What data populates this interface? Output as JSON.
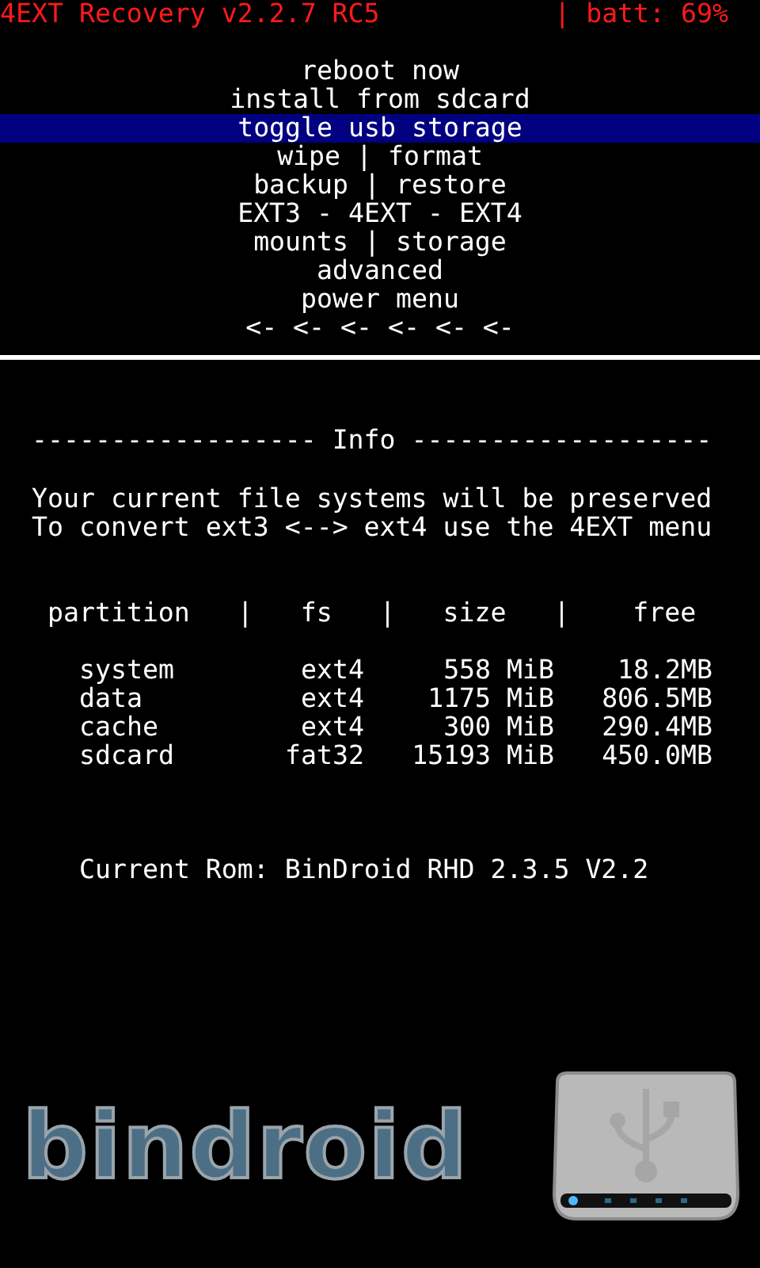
{
  "header": {
    "title": "4EXT Recovery v2.2.7 RC5",
    "battery": "| batt: 69%"
  },
  "menu": [
    {
      "label": "reboot now",
      "selected": false
    },
    {
      "label": "install from sdcard",
      "selected": false
    },
    {
      "label": "toggle usb storage",
      "selected": true
    },
    {
      "label": "wipe | format",
      "selected": false
    },
    {
      "label": "backup | restore",
      "selected": false
    },
    {
      "label": "EXT3 - 4EXT - EXT4",
      "selected": false
    },
    {
      "label": "mounts | storage",
      "selected": false
    },
    {
      "label": "advanced",
      "selected": false
    },
    {
      "label": "power menu",
      "selected": false
    },
    {
      "label": "<- <- <- <- <- <-",
      "selected": false
    }
  ],
  "info": {
    "heading": "------------------ Info -------------------",
    "lines": [
      "Your current file systems will be preserved",
      "To convert ext3 <--> ext4 use the 4EXT menu"
    ]
  },
  "partitions": {
    "header": "partition   |   fs   |   size   |    free",
    "rows": [
      {
        "partition": "system",
        "fs": "ext4",
        "size": "558 MiB",
        "free": "18.2MB"
      },
      {
        "partition": "data",
        "fs": "ext4",
        "size": "1175 MiB",
        "free": "806.5MB"
      },
      {
        "partition": "cache",
        "fs": "ext4",
        "size": "300 MiB",
        "free": "290.4MB"
      },
      {
        "partition": "sdcard",
        "fs": "fat32",
        "size": "15193 MiB",
        "free": "450.0MB"
      }
    ]
  },
  "current_rom": "Current Rom: BinDroid RHD 2.3.5 V2.2",
  "logo": {
    "text": "bindroid"
  }
}
